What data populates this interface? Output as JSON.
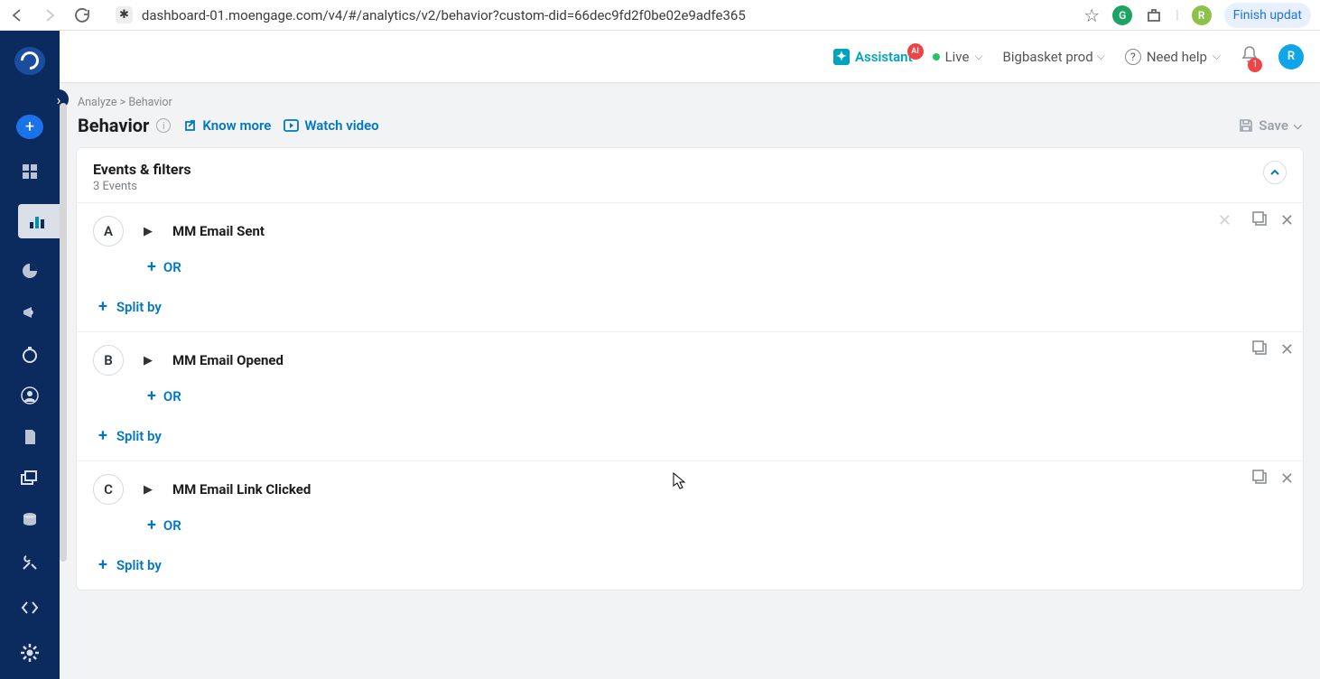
{
  "browser": {
    "url": "dashboard-01.moengage.com/v4/#/analytics/v2/behavior?custom-did=66dec9fd2f0be02e9adfe365",
    "finish_update": "Finish updat",
    "profile_initial": "R"
  },
  "header": {
    "assistant": "Assistant",
    "live": "Live",
    "workspace": "Bigbasket prod",
    "need_help": "Need help",
    "notification_count": "1",
    "user_initial": "R"
  },
  "breadcrumb": {
    "parent": "Analyze",
    "sep": ">",
    "current": "Behavior"
  },
  "page": {
    "title": "Behavior",
    "know_more": "Know more",
    "watch_video": "Watch video",
    "save": "Save"
  },
  "events_panel": {
    "title": "Events & filters",
    "subtitle": "3 Events"
  },
  "events": [
    {
      "letter": "A",
      "name": "MM Email Sent",
      "or": "OR",
      "split": "Split by"
    },
    {
      "letter": "B",
      "name": "MM Email Opened",
      "or": "OR",
      "split": "Split by"
    },
    {
      "letter": "C",
      "name": "MM Email Link Clicked",
      "or": "OR",
      "split": "Split by"
    }
  ]
}
